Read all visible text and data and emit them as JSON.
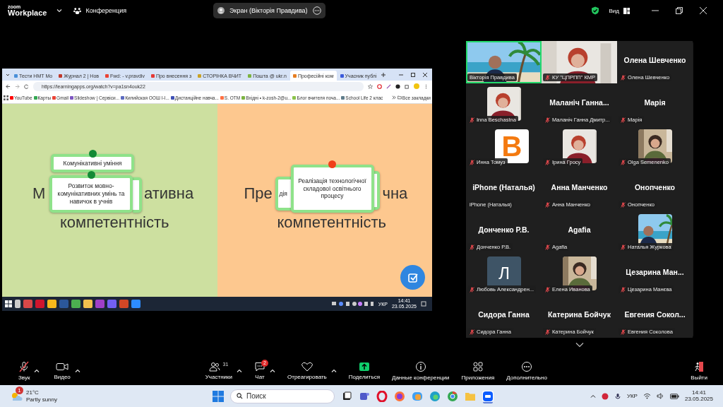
{
  "top_bar": {
    "logo_top": "zoom",
    "logo_bottom": "Workplace",
    "meeting": "Конференция",
    "share_label": "Экран (Вікторія Правдива)",
    "view": "Вид"
  },
  "shared_screen": {
    "tabs": [
      {
        "label": "Тести НМТ Мо",
        "selected": false
      },
      {
        "label": "Журнал 2 | Нов",
        "selected": false
      },
      {
        "label": "Fwd: - v.pravdiv",
        "selected": false
      },
      {
        "label": "Про внесення з",
        "selected": false
      },
      {
        "label": "СТОРІНКА ВЧИТ",
        "selected": false
      },
      {
        "label": "Пошта @ ukr.n",
        "selected": false
      },
      {
        "label": "Професійні ком",
        "selected": true
      },
      {
        "label": "Учасник публі",
        "selected": false
      }
    ],
    "address": "https://learningapps.org/watch?v=pa1sn4ouk22",
    "bookmarks": [
      "YouTube",
      "Карты",
      "Gmail",
      "Slideshow | Сервіси...",
      "Килийская ООШ I-I...",
      "Дистанційне навча...",
      "S. ОТМ",
      "Вхідні • k-zosh-2@u...",
      "Блог вчителя поча...",
      "School Life 2 клас"
    ],
    "all_bookmarks": "Все закладки",
    "panels": [
      {
        "color": "#cde0a0",
        "title": [
          "М",
          "ативна",
          "компетентність"
        ],
        "cards": [
          {
            "kind": "back"
          },
          {
            "kind": "front",
            "text": "Комунікативні уміння",
            "color": "#138a36"
          },
          {
            "kind": "front",
            "text": "Розвиток мовно-комунікативних умінь та навичок в учнів",
            "color": "#138a36"
          }
        ]
      },
      {
        "color": "#fdc88f",
        "title": [
          "Пре",
          "чна",
          "компетентність"
        ],
        "cards": [
          {
            "kind": "back",
            "text": "дія"
          },
          {
            "kind": "back"
          },
          {
            "kind": "front",
            "text": "Реалізація технологічної складової освітнього процесу",
            "color": "#f0401a"
          }
        ]
      }
    ],
    "tray": {
      "lang": "УКР",
      "time": "14:41",
      "date": "23.05.2025"
    }
  },
  "tiles": [
    {
      "kind": "video",
      "tag": "Вікторія Правдива",
      "muted": false,
      "speaking": true
    },
    {
      "kind": "video",
      "tag": "КУ \"ЦПРПП\" КМР",
      "muted": true,
      "speaking": false
    },
    {
      "kind": "name",
      "title": "Олена Шевченко",
      "tag": "Олена Шевченко",
      "muted": true,
      "speaking": false
    },
    {
      "tag": "Inna Beschastna",
      "muted": true,
      "speaking": false
    },
    {
      "kind": "name",
      "title": "Маланіч Ганна...",
      "tag": "Маланіч Ганна Дмитр...",
      "muted": true,
      "speaking": false
    },
    {
      "kind": "name",
      "title": "Марія",
      "tag": "Марія",
      "muted": true,
      "speaking": false
    },
    {
      "kind": "logo",
      "title": "B",
      "tag": "Инна Томуз",
      "muted": true,
      "speaking": false
    },
    {
      "tag": "Ірина  Гросу",
      "muted": true,
      "speaking": false
    },
    {
      "tag": "Olga Semenenko",
      "muted": true,
      "speaking": false
    },
    {
      "kind": "name",
      "title": "iPhone (Наталья)",
      "tag": "iPhone (Наталья)",
      "muted": false,
      "speaking": false
    },
    {
      "kind": "name",
      "title": "Анна Манченко",
      "tag": "Анна Манченко",
      "muted": true,
      "speaking": false
    },
    {
      "kind": "name",
      "title": "Онопченко",
      "tag": "Онопченко",
      "muted": true,
      "speaking": false
    },
    {
      "kind": "name",
      "title": "Донченко Р.В.",
      "tag": "Донченко Р.В.",
      "muted": true,
      "speaking": false
    },
    {
      "kind": "name",
      "title": "Agafia",
      "tag": "Agafia",
      "muted": true,
      "speaking": false
    },
    {
      "tag": "Наталья Журкова",
      "muted": true,
      "speaking": false
    },
    {
      "kind": "letter",
      "title": "Л",
      "tag": "Любовь Александрен...",
      "muted": true,
      "speaking": false
    },
    {
      "tag": "Елена Иванова",
      "muted": true,
      "speaking": false
    },
    {
      "kind": "name",
      "title": "Цезарина  Ман...",
      "tag": "Цезарина Манєва",
      "muted": true,
      "speaking": false
    },
    {
      "kind": "name",
      "title": "Сидора Ганна",
      "tag": "Сидора Ганна",
      "muted": true,
      "speaking": false
    },
    {
      "kind": "name",
      "title": "Катерина Бойчук",
      "tag": "Катерина Бойчук",
      "muted": true,
      "speaking": false
    },
    {
      "kind": "name",
      "title": "Евгения  Сокол...",
      "tag": "Евгения Соколова",
      "muted": true,
      "speaking": false
    }
  ],
  "toolbar": {
    "left": [
      {
        "kind": "mic",
        "label": "Звук",
        "muted": true,
        "menu": true
      },
      {
        "kind": "video",
        "label": "Видео",
        "muted": false,
        "menu": true
      }
    ],
    "center": [
      {
        "kind": "participants",
        "label": "Участники",
        "count": "31",
        "menu": true
      },
      {
        "kind": "chat",
        "label": "Чат",
        "badge": "2",
        "menu": true
      },
      {
        "kind": "react",
        "label": "Отреагировать",
        "menu": true
      },
      {
        "kind": "share",
        "label": "Поделиться",
        "menu": false
      },
      {
        "kind": "info",
        "label": "Данные конференции",
        "menu": false
      },
      {
        "kind": "apps",
        "label": "Приложения",
        "menu": false
      },
      {
        "kind": "more",
        "label": "Дополнительно",
        "menu": false
      }
    ],
    "right": [
      {
        "kind": "leave",
        "label": "Выйти",
        "menu": false
      }
    ]
  },
  "taskbar": {
    "weather_badge": "1",
    "temperature": "21°C",
    "condition": "Partly sunny",
    "search_placeholder": "Поиск",
    "lang": "УКР",
    "time": "14:41",
    "date": "23.05.2025"
  }
}
